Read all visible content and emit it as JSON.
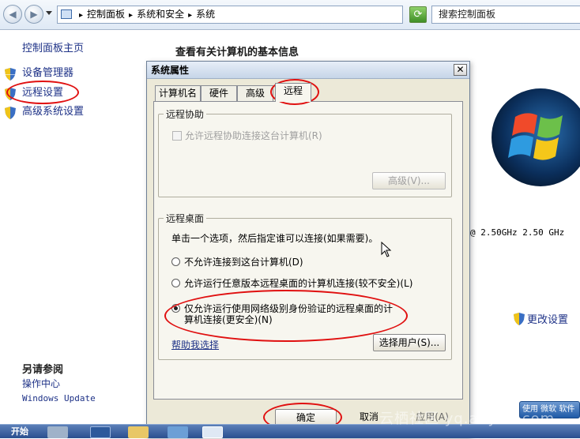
{
  "address_bar": {
    "path": [
      "控制面板",
      "系统和安全",
      "系统"
    ],
    "search_placeholder": "搜索控制面板"
  },
  "left_nav": {
    "home_link": "控制面板主页",
    "tasks": [
      "设备管理器",
      "远程设置",
      "高级系统设置"
    ],
    "see_also_title": "另请参阅",
    "see_also_links": [
      "操作中心",
      "Windows Update"
    ]
  },
  "main": {
    "title": "查看有关计算机的基本信息",
    "cpu_info": "@ 2.50GHz   2.50 GHz",
    "change_settings": "更改设置",
    "activate_text": "使用 微软 软件"
  },
  "dialog": {
    "title": "系统属性",
    "close_glyph": "✕",
    "tabs": [
      "计算机名",
      "硬件",
      "高级",
      "远程"
    ],
    "active_tab": "远程",
    "remote_assistance": {
      "legend": "远程协助",
      "checkbox_label": "允许远程协助连接这台计算机(R)",
      "checked": false,
      "advanced_button": "高级(V)..."
    },
    "remote_desktop": {
      "legend": "远程桌面",
      "description": "单击一个选项，然后指定谁可以连接(如果需要)。",
      "options": [
        "不允许连接到这台计算机(D)",
        "允许运行任意版本远程桌面的计算机连接(较不安全)(L)",
        "仅允许运行使用网络级别身份验证的远程桌面的计算机连接(更安全)(N)"
      ],
      "selected_index": 2,
      "help_link": "帮助我选择",
      "select_users_button": "选择用户(S)..."
    },
    "buttons": {
      "ok": "确定",
      "cancel": "取消",
      "apply": "应用(A)"
    }
  },
  "taskbar": {
    "start_label": "开始"
  },
  "watermark": "云栖社区 yq.aliyun.com",
  "colors": {
    "link": "#1e3287",
    "annotation": "#e01010",
    "dialog_bg": "#ece9d8"
  }
}
